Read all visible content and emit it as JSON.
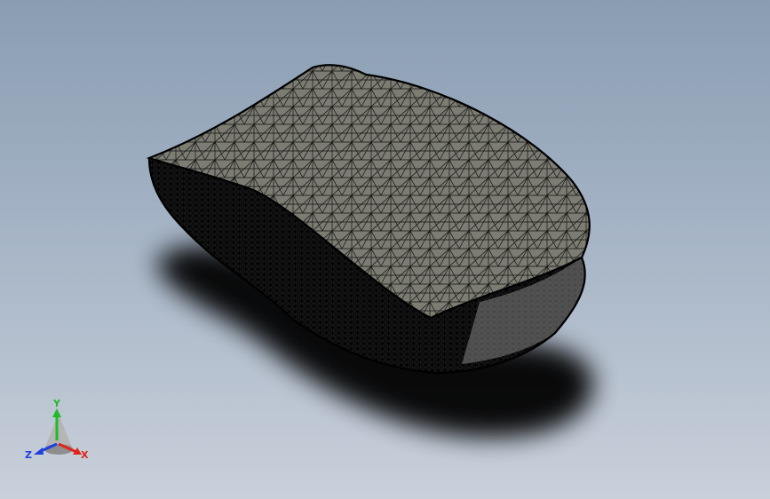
{
  "viewport": {
    "background_top": "#8a9db2",
    "background_bottom": "#c9d0da"
  },
  "model": {
    "display_mode": "mesh-wireframe-shaded",
    "face_color": "#7c7c73",
    "edge_color": "#000000",
    "shadow_color": "#000000"
  },
  "triad": {
    "x_label": "X",
    "y_label": "Y",
    "z_label": "Z",
    "x_color": "#e0241b",
    "y_color": "#22b92a",
    "z_color": "#1f3fe0"
  }
}
